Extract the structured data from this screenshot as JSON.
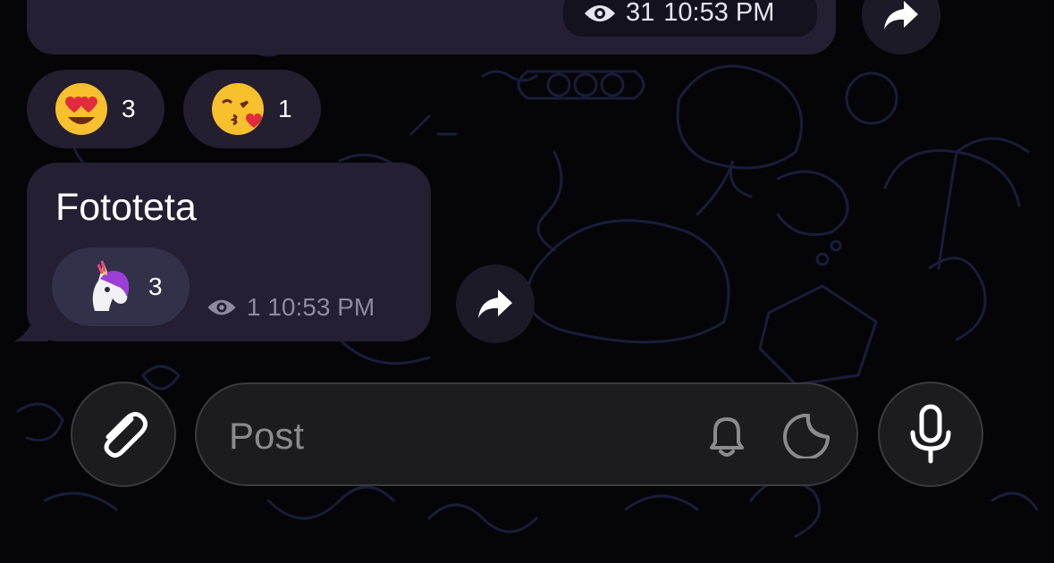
{
  "colors": {
    "background": "#050508",
    "bubble": "#241f33",
    "reaction_bg": "#231e30",
    "composer_bg": "#1c1c1e",
    "meta_text": "#8e8aa0"
  },
  "top_message": {
    "views": "31",
    "time": "10:53 PM",
    "views_icon": "eye-icon",
    "forward_icon": "share-arrow-icon"
  },
  "reactions": [
    {
      "emoji": "heart-eyes-face",
      "count": "3"
    },
    {
      "emoji": "kissing-face-with-heart",
      "count": "1"
    }
  ],
  "message": {
    "text": "Fototeta",
    "reaction": {
      "emoji": "unicorn",
      "count": "3"
    },
    "views": "1",
    "time": "10:53 PM",
    "forward_icon": "share-arrow-icon"
  },
  "composer": {
    "placeholder": "Post",
    "attach_icon": "paperclip-icon",
    "bell_icon": "bell-icon",
    "sticker_icon": "sticker-icon",
    "mic_icon": "microphone-icon"
  }
}
